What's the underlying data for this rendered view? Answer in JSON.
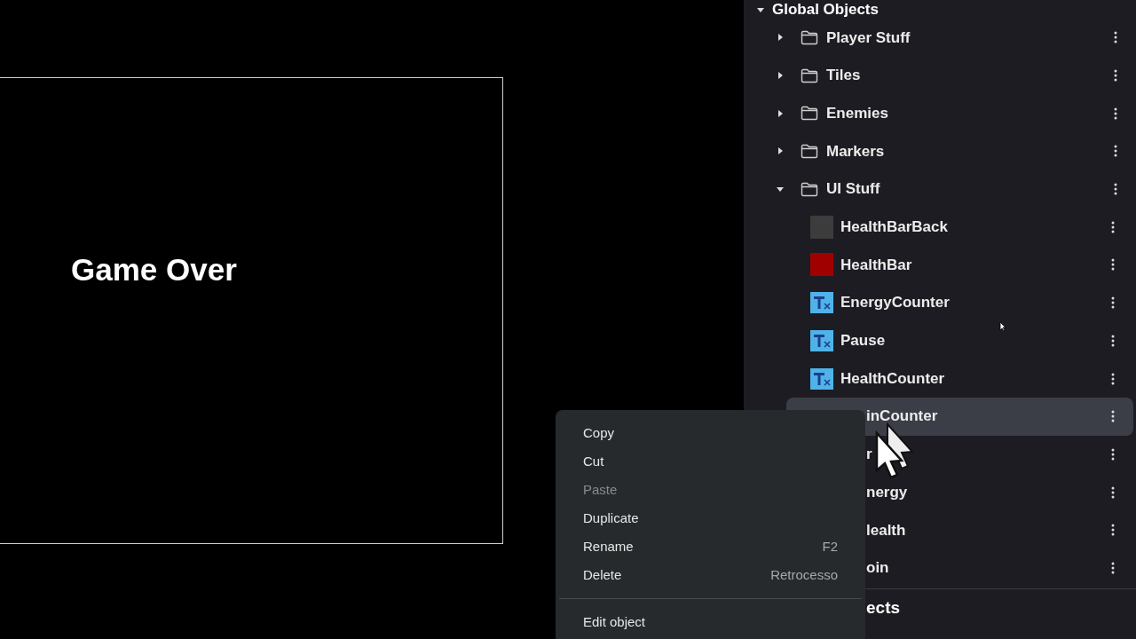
{
  "canvas": {
    "text": "Game Over"
  },
  "objects_panel": {
    "title": "Global Objects",
    "expanded": true,
    "items": [
      {
        "name": "Player Stuff",
        "kind": "folder",
        "expanded": false,
        "selected": false
      },
      {
        "name": "Tiles",
        "kind": "folder",
        "expanded": false,
        "selected": false
      },
      {
        "name": "Enemies",
        "kind": "folder",
        "expanded": false,
        "selected": false
      },
      {
        "name": "Markers",
        "kind": "folder",
        "expanded": false,
        "selected": false
      },
      {
        "name": "UI Stuff",
        "kind": "folder",
        "expanded": true,
        "selected": false,
        "children": [
          {
            "name": "HealthBarBack",
            "kind": "sprite",
            "color": "#3c3c3c",
            "selected": false
          },
          {
            "name": "HealthBar",
            "kind": "sprite",
            "color": "#a00000",
            "selected": false
          },
          {
            "name": "EnergyCounter",
            "kind": "text",
            "selected": false
          },
          {
            "name": "Pause",
            "kind": "text",
            "selected": false
          },
          {
            "name": "HealthCounter",
            "kind": "text",
            "selected": false
          },
          {
            "name": "inCounter",
            "kind": "covered",
            "selected": true
          },
          {
            "name": "r",
            "kind": "covered",
            "selected": false
          },
          {
            "name": "nergy",
            "kind": "covered",
            "selected": false
          },
          {
            "name": "lealth",
            "kind": "covered",
            "selected": false
          },
          {
            "name": "oin",
            "kind": "covered",
            "selected": false
          }
        ]
      }
    ],
    "next_section": "ects"
  },
  "context_menu": [
    {
      "label": "Copy",
      "disabled": false
    },
    {
      "label": "Cut",
      "disabled": false
    },
    {
      "label": "Paste",
      "disabled": true
    },
    {
      "label": "Duplicate",
      "disabled": false
    },
    {
      "label": "Rename",
      "shortcut": "F2",
      "disabled": false
    },
    {
      "label": "Delete",
      "shortcut": "Retrocesso",
      "disabled": false
    },
    {
      "kind": "divider"
    },
    {
      "label": "Edit object",
      "disabled": false
    }
  ]
}
